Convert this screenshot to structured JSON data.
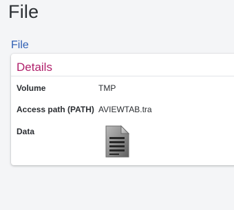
{
  "page": {
    "title": "File",
    "section_link": "File"
  },
  "details": {
    "title": "Details",
    "fields": [
      {
        "label": "Volume",
        "value": "TMP"
      },
      {
        "label": "Access path (PATH)",
        "value": "AVIEWTAB.tra"
      },
      {
        "label": "Data",
        "value": ""
      }
    ],
    "data_icon": "document-icon"
  },
  "colors": {
    "page_background": "#f4f5f7",
    "title_text": "#2b2f33",
    "link": "#2f5fb4",
    "card_title": "#b01e6a",
    "card_background": "#ffffff"
  }
}
